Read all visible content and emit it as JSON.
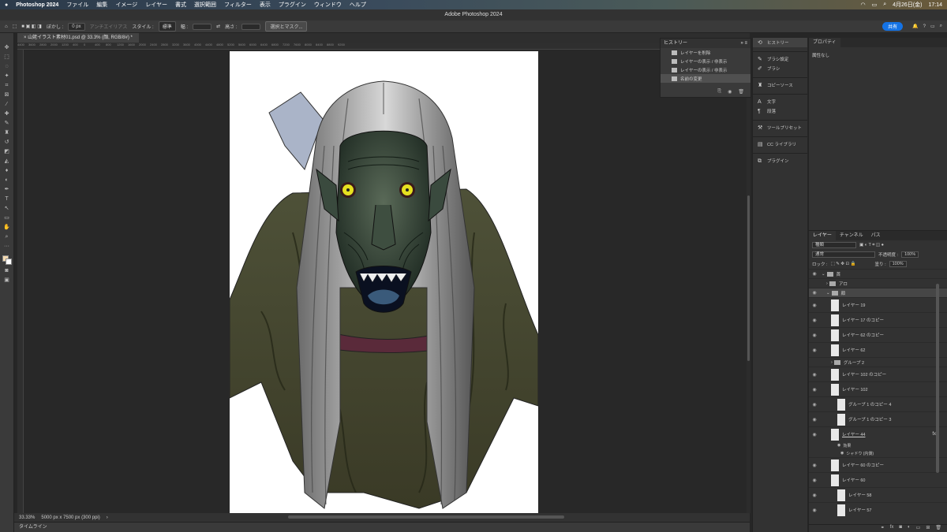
{
  "menubar": {
    "app": "Photoshop 2024",
    "items": [
      "ファイル",
      "編集",
      "イメージ",
      "レイヤー",
      "書式",
      "選択範囲",
      "フィルター",
      "表示",
      "プラグイン",
      "ウィンドウ",
      "ヘルプ"
    ],
    "date": "4月26日(金)",
    "time": "17:14"
  },
  "window": {
    "title": "Adobe Photoshop 2024"
  },
  "options": {
    "feather_label": "ぼかし :",
    "feather_value": "0 px",
    "antialias": "アンチエイリアス",
    "style_label": "スタイル :",
    "style_value": "標準",
    "width_label": "幅 :",
    "height_label": "高さ :",
    "mask_button": "選択とマスク...",
    "share": "共有"
  },
  "document": {
    "tab": "山姥イラスト素材01.psd @ 33.3% (顔, RGB/8#) *"
  },
  "ruler": [
    "4400",
    "3600",
    "2800",
    "2000",
    "1200",
    "400",
    "0",
    "400",
    "800",
    "1200",
    "1600",
    "2000",
    "2400",
    "2800",
    "3200",
    "3600",
    "4000",
    "4400",
    "4800",
    "5200",
    "5600",
    "6000",
    "6400",
    "6800",
    "7200",
    "7600",
    "8000",
    "8400",
    "8800",
    "9200"
  ],
  "status": {
    "zoom": "33.33%",
    "size": "5000 px x 7500 px (300 ppi)"
  },
  "timeline": "タイムライン",
  "history": {
    "title": "ヒストリー",
    "items": [
      "レイヤーを削除",
      "レイヤーの表示 / 非表示",
      "レイヤーの表示 / 非表示",
      "名前の変更"
    ]
  },
  "dock": {
    "history": "ヒストリー",
    "brush_settings": "ブラシ設定",
    "brush": "ブラシ",
    "clone_source": "コピーソース",
    "character": "文字",
    "paragraph": "段落",
    "tool_presets": "ツールプリセット",
    "cc_libraries": "CC ライブラリ",
    "plugins": "プラグイン"
  },
  "properties": {
    "title": "プロパティ",
    "body": "属性なし"
  },
  "layers": {
    "tabs": [
      "レイヤー",
      "チャンネル",
      "パス"
    ],
    "filter": "種類",
    "blend": "通常",
    "opacity_label": "不透明度 :",
    "opacity": "100%",
    "lock_label": "ロック :",
    "fill_label": "塗り :",
    "fill": "100%",
    "items": [
      {
        "name": "首",
        "type": "group"
      },
      {
        "name": "アロ",
        "type": "group"
      },
      {
        "name": "顔",
        "type": "group"
      },
      {
        "name": "レイヤー 19",
        "type": "layer"
      },
      {
        "name": "レイヤー 17 のコピー",
        "type": "layer"
      },
      {
        "name": "レイヤー 62 のコピー",
        "type": "layer"
      },
      {
        "name": "レイヤー 62",
        "type": "layer"
      },
      {
        "name": "グループ 2",
        "type": "group"
      },
      {
        "name": "レイヤー 102 のコピー",
        "type": "layer"
      },
      {
        "name": "レイヤー 102",
        "type": "layer"
      },
      {
        "name": "グループ 1 のコピー 4",
        "type": "layer"
      },
      {
        "name": "グループ 1 のコピー 3",
        "type": "layer"
      },
      {
        "name": "レイヤー 44",
        "type": "layer",
        "fx": "fx"
      },
      {
        "name": "効果",
        "type": "effect"
      },
      {
        "name": "シャドウ (内側)",
        "type": "effect"
      },
      {
        "name": "レイヤー 60 のコピー",
        "type": "layer"
      },
      {
        "name": "レイヤー 60",
        "type": "layer"
      },
      {
        "name": "レイヤー 58",
        "type": "layer"
      },
      {
        "name": "レイヤー 57",
        "type": "layer"
      }
    ]
  }
}
